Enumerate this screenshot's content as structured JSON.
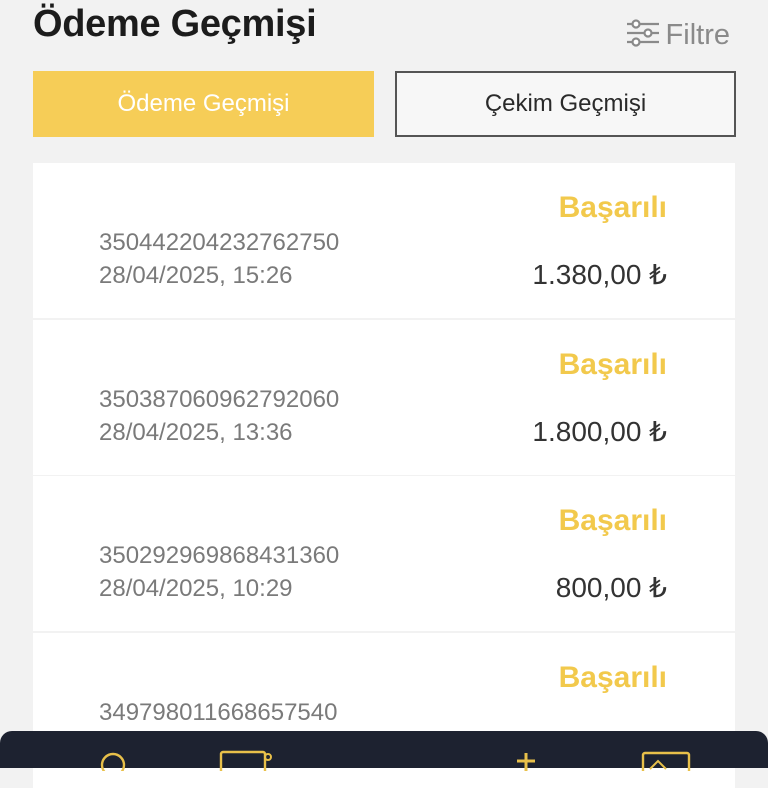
{
  "header": {
    "title": "Ödeme Geçmişi",
    "filter_label": "Filtre",
    "filter_icon": "sliders-icon"
  },
  "tabs": [
    {
      "label": "Ödeme Geçmişi",
      "active": true
    },
    {
      "label": "Çekim Geçmişi",
      "active": false
    }
  ],
  "transactions": [
    {
      "status": "Başarılı",
      "id": "350442204232762750",
      "date": "28/04/2025, 15:26",
      "amount": "1.380,00 ₺"
    },
    {
      "status": "Başarılı",
      "id": "350387060962792060",
      "date": "28/04/2025, 13:36",
      "amount": "1.800,00 ₺"
    },
    {
      "status": "Başarılı",
      "id": "350292969868431360",
      "date": "28/04/2025, 10:29",
      "amount": "800,00 ₺"
    },
    {
      "status": "Başarılı",
      "id": "349798011668657540",
      "date": "",
      "amount": ""
    }
  ],
  "bottom_nav": {
    "icons": [
      "clock-icon",
      "wallet-icon",
      "plus-icon",
      "card-icon"
    ]
  },
  "colors": {
    "accent": "#f6cd57",
    "status_success": "#f2c94c",
    "nav_bg": "#1d2230",
    "page_bg": "#f2f2f2"
  }
}
